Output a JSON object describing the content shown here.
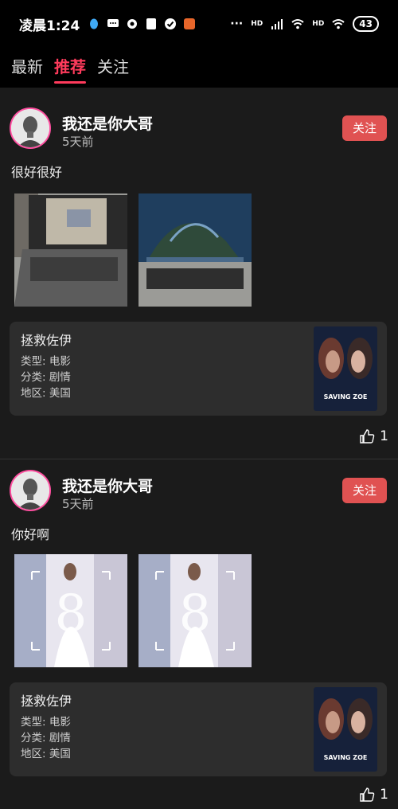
{
  "status": {
    "time": "凌晨1:24",
    "battery": "43",
    "dots": "···",
    "hd1": "HD",
    "hd2": "HD"
  },
  "tabs": [
    {
      "label": "最新"
    },
    {
      "label": "推荐"
    },
    {
      "label": "关注"
    }
  ],
  "posts": [
    {
      "username": "我还是你大哥",
      "time": "5天前",
      "follow_label": "关注",
      "text": "很好很好",
      "movie": {
        "title": "拯救佐伊",
        "type": "类型: 电影",
        "genre": "分类: 剧情",
        "region": "地区: 美国",
        "poster_text": "SAVING ZOE"
      },
      "likes": "1"
    },
    {
      "username": "我还是你大哥",
      "time": "5天前",
      "follow_label": "关注",
      "text": "你好啊",
      "movie": {
        "title": "拯救佐伊",
        "type": "类型: 电影",
        "genre": "分类: 剧情",
        "region": "地区: 美国",
        "poster_text": "SAVING ZOE"
      },
      "likes": "1"
    }
  ],
  "colors": {
    "accent": "#ff3b5c",
    "follow_bg": "#e05252",
    "card_bg": "#2d2d2d",
    "avatar_ring": "#ff4fa0"
  }
}
